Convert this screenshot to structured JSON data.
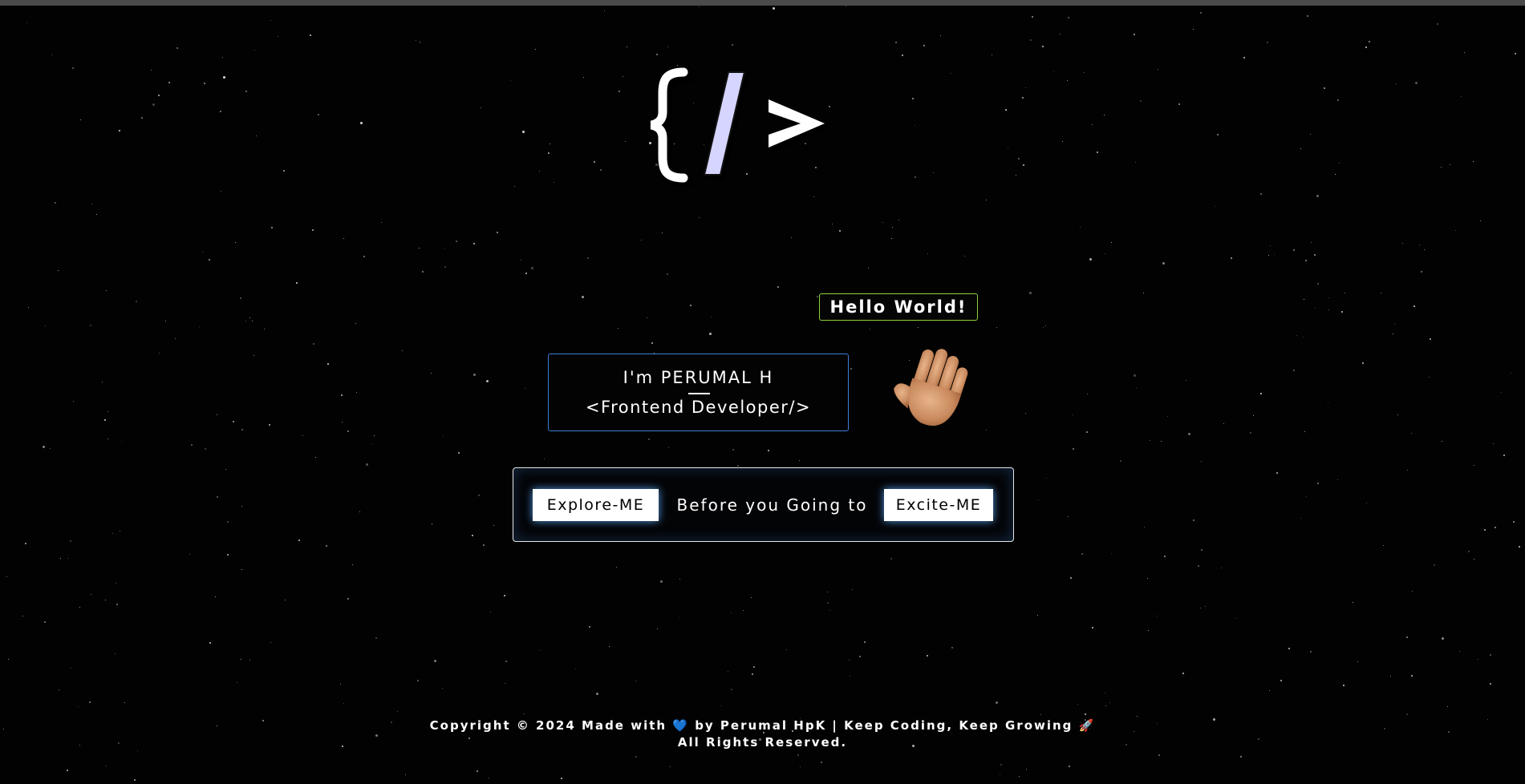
{
  "logo": {
    "left_brace": "{",
    "slash": "/",
    "right_angle": ">"
  },
  "hello": {
    "label": "Hello World!"
  },
  "intro": {
    "name": "I'm PERUMAL H",
    "role": "<Frontend Developer/>"
  },
  "cta": {
    "explore_label": "Explore-ME",
    "middle_text": "Before you Going to",
    "excite_label": "Excite-ME"
  },
  "footer": {
    "line1_before": "Copyright © 2024 Made with ",
    "heart": "💙",
    "line1_after": " by Perumal HpK | Keep Coding, Keep Growing 🚀",
    "line2": "All Rights Reserved."
  },
  "colors": {
    "hello_border": "#8bd33a",
    "intro_border": "#3a7fd6",
    "button_glow": "#5aaaff",
    "slash_fill": "#d6d5ff"
  },
  "icons": {
    "hand": "waving-hand-icon",
    "logo": "code-brackets-logo"
  }
}
